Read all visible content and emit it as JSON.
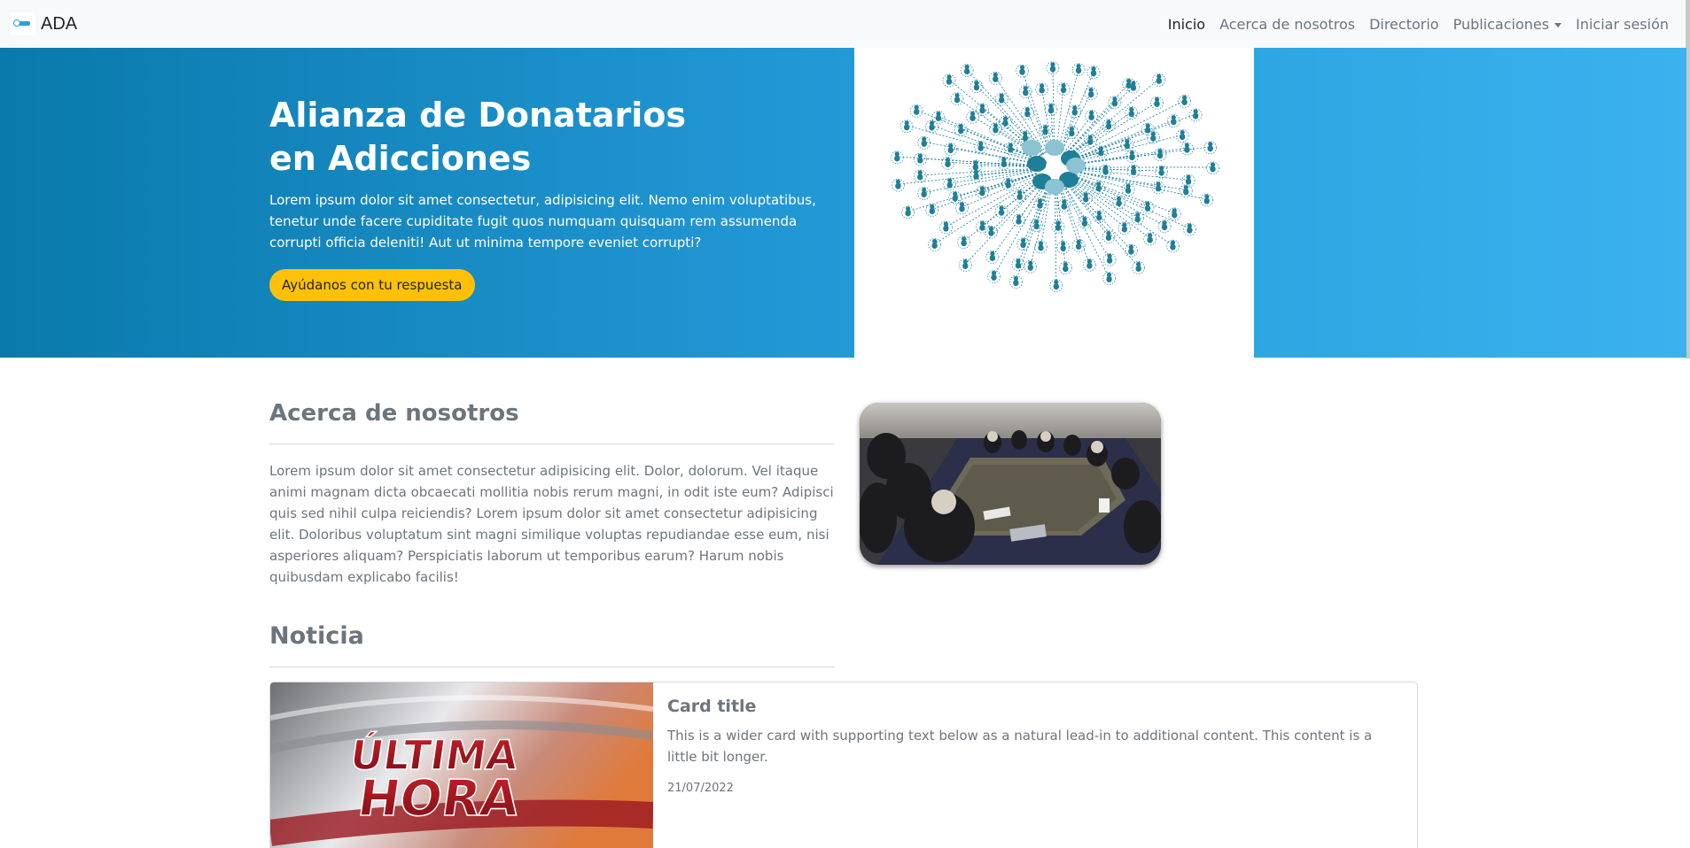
{
  "navbar": {
    "brand": "ADA",
    "links": [
      {
        "label": "Inicio"
      },
      {
        "label": "Acerca de nosotros"
      },
      {
        "label": "Directorio"
      },
      {
        "label": "Publicaciones"
      },
      {
        "label": "Iniciar sesión"
      }
    ]
  },
  "hero": {
    "title": "Alianza de Donatarios en Adicciones",
    "description": "Lorem ipsum dolor sit amet consectetur, adipisicing elit. Nemo enim voluptatibus, tenetur unde facere cupiditate fugit quos numquam quisquam rem assumenda corrupti officia deleniti! Aut ut minima tempore eveniet corrupti?",
    "button": "Ayúdanos con tu respuesta"
  },
  "about": {
    "heading": "Acerca de nosotros",
    "text": "Lorem ipsum dolor sit amet consectetur adipisicing elit. Dolor, dolorum. Vel itaque animi magnam dicta obcaecati mollitia nobis rerum magni, in odit iste eum? Adipisci quis sed nihil culpa reiciendis? Lorem ipsum dolor sit amet consectetur adipisicing elit. Doloribus voluptatum sint magni similique voluptas repudiandae esse eum, nisi asperiores aliquam? Perspiciatis laborum ut temporibus earum? Harum nobis quibusdam explicabo facilis!"
  },
  "news": {
    "heading": "Noticia",
    "card": {
      "image_text_line1": "ÚLTIMA",
      "image_text_line2": "HORA",
      "title": "Card title",
      "text": "This is a wider card with supporting text below as a natural lead-in to additional content. This content is a little bit longer.",
      "date": "21/07/2022"
    }
  },
  "colors": {
    "accent": "#ffc107",
    "hero_start": "#0a7aab",
    "hero_end": "#3bb2ef",
    "network": "#1f7f99"
  }
}
